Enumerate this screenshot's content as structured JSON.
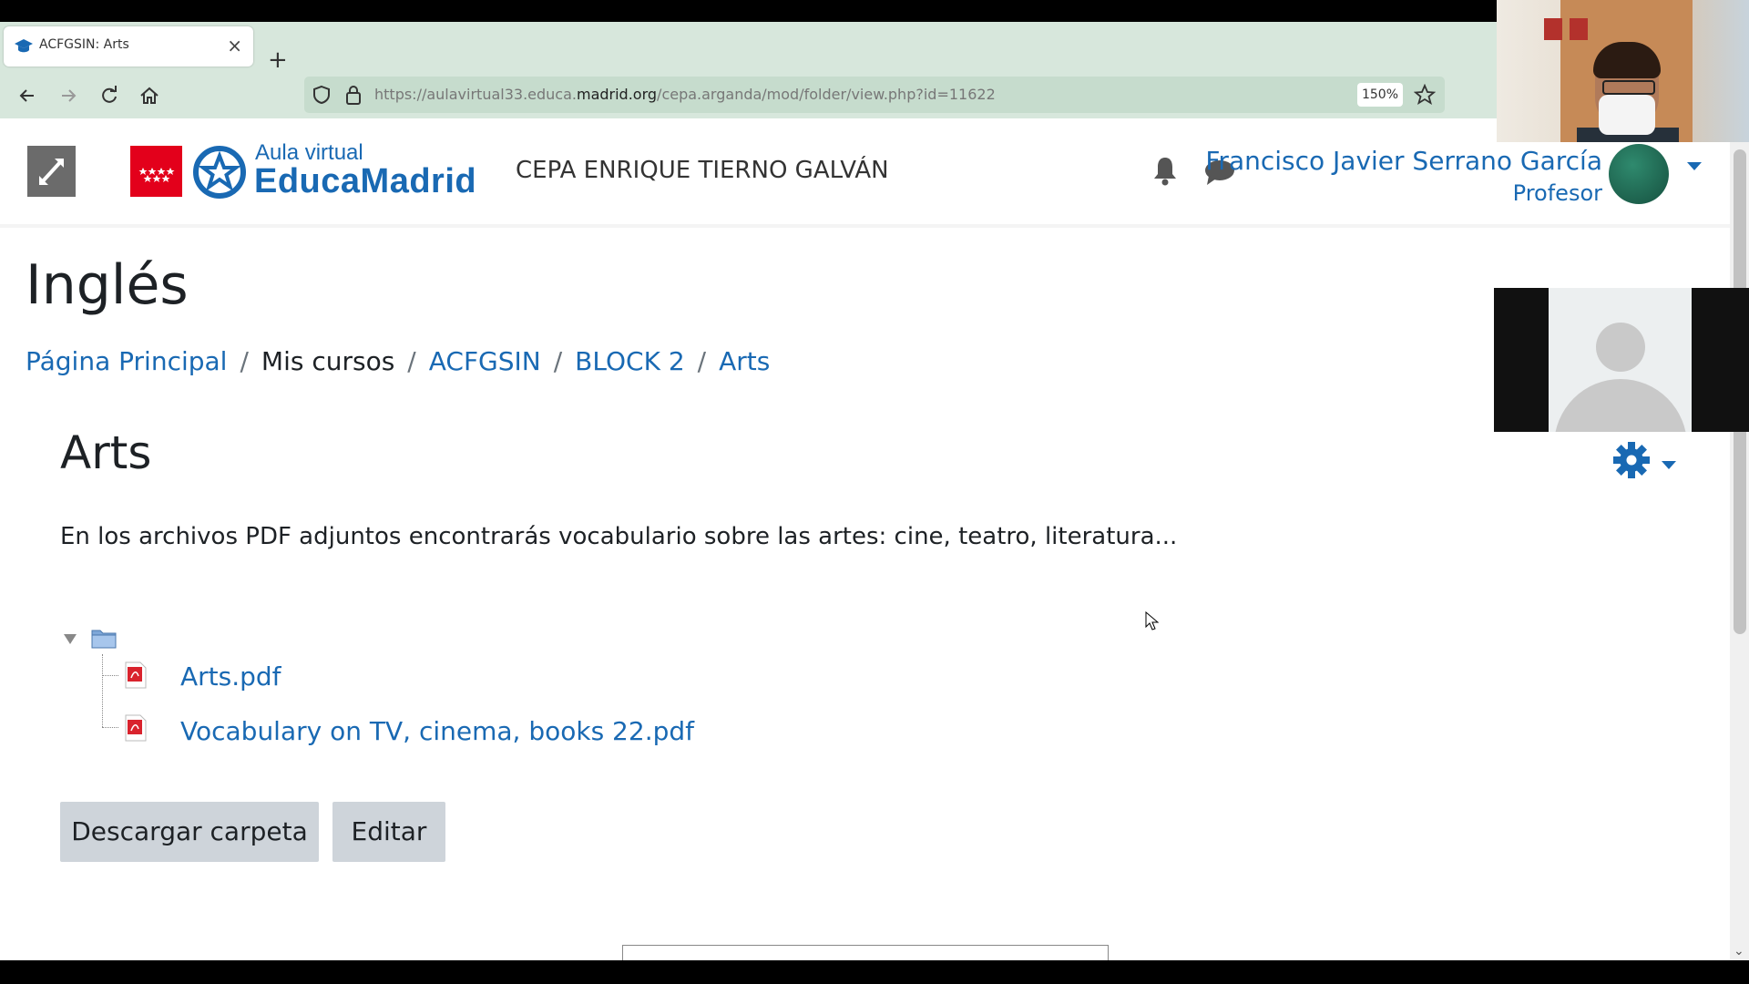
{
  "browser": {
    "tab_title": "ACFGSIN: Arts",
    "tab_close": "×",
    "new_tab": "+",
    "url_prefix": "https://aulavirtual33.educa.",
    "url_domain": "madrid.org",
    "url_path": "/cepa.arganda/mod/folder/view.php?id=11622",
    "zoom": "150%"
  },
  "header": {
    "logo_small": "Aula virtual",
    "logo_big": "EducaMadrid",
    "site_name": "CEPA ENRIQUE TIERNO GALVÁN",
    "user_name": "Francisco Javier Serrano García",
    "user_role": "Profesor"
  },
  "page": {
    "course_title": "Inglés",
    "breadcrumb": [
      {
        "label": "Página Principal"
      },
      {
        "label": "Mis cursos"
      },
      {
        "label": "ACFGSIN"
      },
      {
        "label": "BLOCK 2"
      },
      {
        "label": "Arts"
      }
    ],
    "breadcrumb_sep": "/",
    "section_title": "Arts",
    "description": "En los archivos PDF adjuntos encontrarás vocabulario sobre las artes: cine, teatro, literatura...",
    "files": [
      {
        "name": "Arts.pdf"
      },
      {
        "name": "Vocabulary on TV, cinema, books 22.pdf"
      }
    ],
    "buttons": {
      "download": "Descargar carpeta",
      "edit": "Editar"
    }
  },
  "colors": {
    "link": "#1969b3",
    "browser_chrome": "#d7e7dc",
    "madrid_red": "#e3001b"
  }
}
